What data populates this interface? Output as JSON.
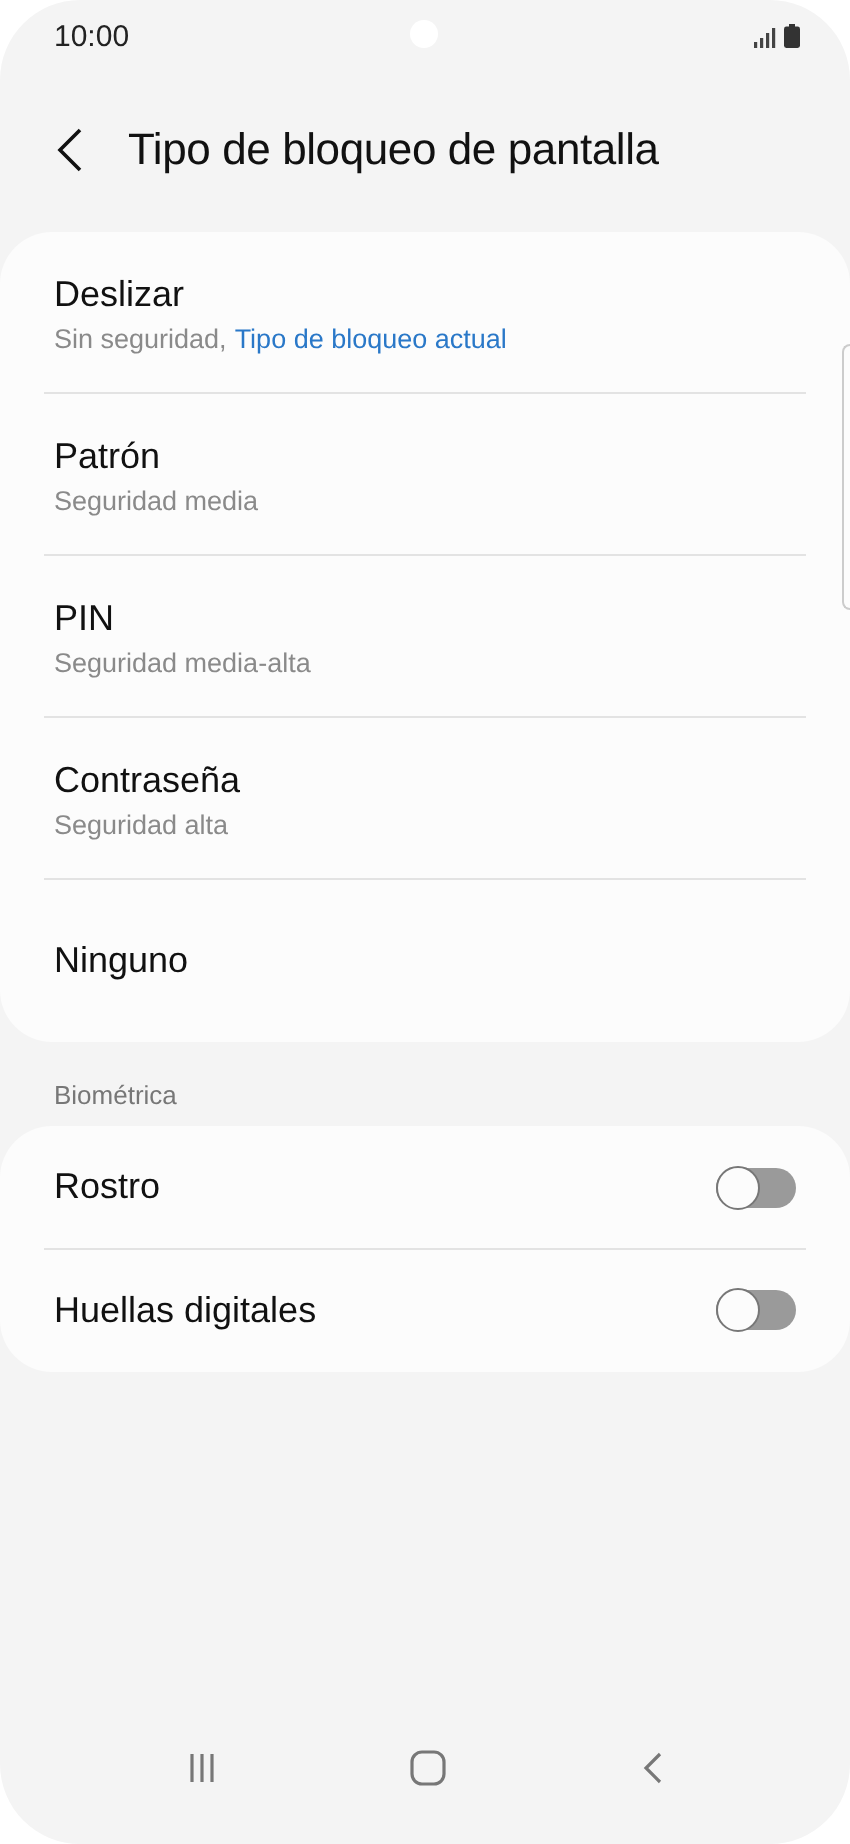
{
  "status_bar": {
    "time": "10:00"
  },
  "header": {
    "title": "Tipo de bloqueo de pantalla"
  },
  "lock_types": [
    {
      "title": "Deslizar",
      "subtitle": "Sin seguridad,",
      "current": "Tipo de bloqueo actual"
    },
    {
      "title": "Patrón",
      "subtitle": "Seguridad media"
    },
    {
      "title": "PIN",
      "subtitle": "Seguridad media-alta"
    },
    {
      "title": "Contraseña",
      "subtitle": "Seguridad alta"
    },
    {
      "title": "Ninguno"
    }
  ],
  "biometrics": {
    "heading": "Biométrica",
    "items": [
      {
        "title": "Rostro",
        "on": false
      },
      {
        "title": "Huellas digitales",
        "on": false
      }
    ]
  }
}
